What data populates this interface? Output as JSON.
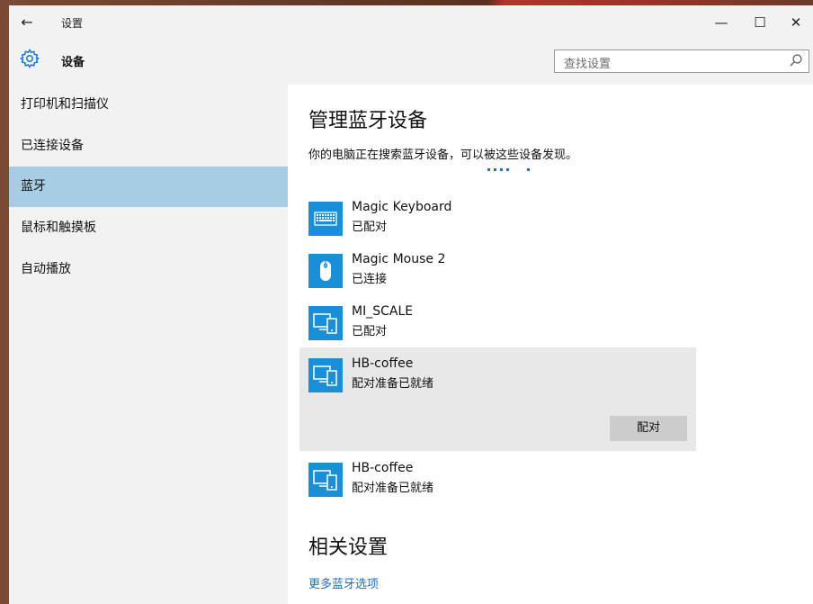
{
  "window": {
    "title": "设置",
    "back_icon": "back-arrow-icon",
    "minimize": "—",
    "maximize": "☐",
    "close": "✕"
  },
  "header": {
    "title": "设备",
    "icon": "gear-icon",
    "search_placeholder": "查找设置"
  },
  "sidebar": {
    "items": [
      {
        "label": "打印机和扫描仪",
        "active": false
      },
      {
        "label": "已连接设备",
        "active": false
      },
      {
        "label": "蓝牙",
        "active": true
      },
      {
        "label": "鼠标和触摸板",
        "active": false
      },
      {
        "label": "自动播放",
        "active": false
      }
    ]
  },
  "main": {
    "title": "管理蓝牙设备",
    "description": "你的电脑正在搜索蓝牙设备，可以被这些设备发现。",
    "devices": [
      {
        "name": "Magic Keyboard",
        "status": "已配对",
        "icon": "keyboard-icon"
      },
      {
        "name": "Magic Mouse 2",
        "status": "已连接",
        "icon": "mouse-icon"
      },
      {
        "name": "MI_SCALE",
        "status": "已配对",
        "icon": "device-icon"
      },
      {
        "name": "HB-coffee",
        "status": "配对准备已就绪",
        "icon": "device-icon",
        "selected": true,
        "action": "配对"
      },
      {
        "name": "HB-coffee",
        "status": "配对准备已就绪",
        "icon": "device-icon"
      }
    ],
    "related_title": "相关设置",
    "related_link": "更多蓝牙选项"
  },
  "colors": {
    "accent": "#1a8fd8",
    "nav_active": "#a7cde4",
    "link": "#1a6fc0"
  }
}
